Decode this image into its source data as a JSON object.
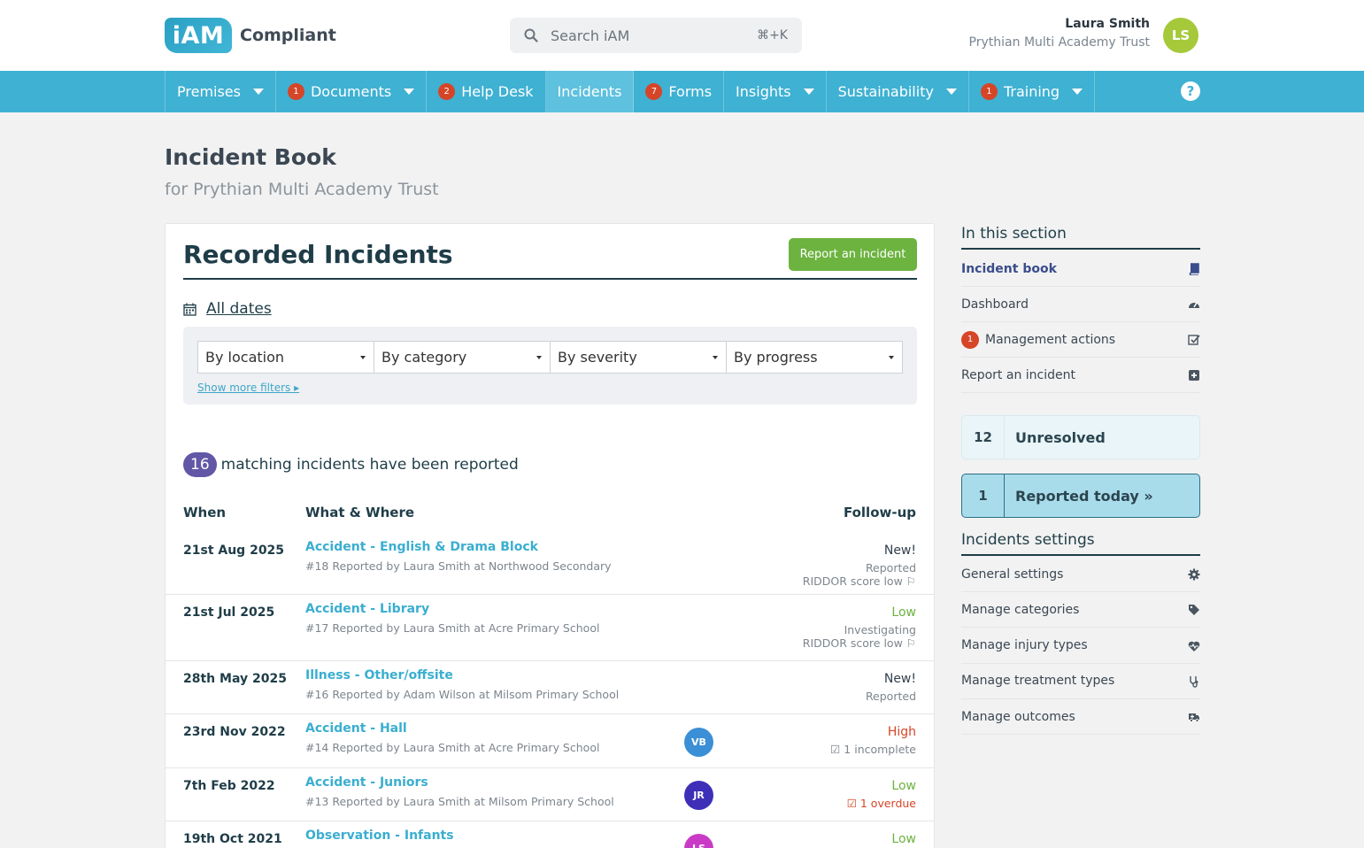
{
  "header": {
    "logo_mark": "iAM",
    "logo_text": "Compliant",
    "search_placeholder": "Search iAM",
    "search_shortcut": "⌘+K",
    "user_name": "Laura Smith",
    "user_org": "Prythian Multi Academy Trust",
    "user_initials": "LS"
  },
  "nav": {
    "items": [
      {
        "label": "Premises",
        "badge": "",
        "dropdown": true
      },
      {
        "label": "Documents",
        "badge": "1",
        "dropdown": true
      },
      {
        "label": "Help Desk",
        "badge": "2",
        "dropdown": false
      },
      {
        "label": "Incidents",
        "badge": "",
        "dropdown": false,
        "active": true
      },
      {
        "label": "Forms",
        "badge": "7",
        "dropdown": false
      },
      {
        "label": "Insights",
        "badge": "",
        "dropdown": true
      },
      {
        "label": "Sustainability",
        "badge": "",
        "dropdown": true
      },
      {
        "label": "Training",
        "badge": "1",
        "dropdown": true
      }
    ],
    "help_glyph": "?"
  },
  "page": {
    "title": "Incident Book",
    "subtitle": "for Prythian Multi Academy Trust"
  },
  "incidents": {
    "title": "Recorded Incidents",
    "report_button": "Report an incident",
    "dates_label": "All dates",
    "filters": [
      "By location",
      "By category",
      "By severity",
      "By progress"
    ],
    "more_filters": "Show more filters ▸",
    "count": "16",
    "count_text": "matching incidents have been reported",
    "headers": {
      "when": "When",
      "what": "What & Where",
      "followup": "Follow-up"
    },
    "rows": [
      {
        "when": "21st Aug 2025",
        "what": "Accident - English & Drama Block",
        "meta": "#18 Reported by Laura Smith at Northwood Secondary",
        "severity": "New!",
        "severity_color": "#33414e",
        "status": "Reported",
        "riddor": "RIDDOR score low ⚐",
        "assignee": "",
        "assignee_color": ""
      },
      {
        "when": "21st Jul 2025",
        "what": "Accident - Library",
        "meta": "#17 Reported by Laura Smith at Acre Primary School",
        "severity": "Low",
        "severity_color": "#6cb33f",
        "status": "Investigating",
        "riddor": "RIDDOR score low ⚐",
        "assignee": "",
        "assignee_color": ""
      },
      {
        "when": "28th May 2025",
        "what": "Illness - Other/offsite",
        "meta": "#16 Reported by Adam Wilson at Milsom Primary School",
        "severity": "New!",
        "severity_color": "#33414e",
        "status": "Reported",
        "riddor": "",
        "assignee": "",
        "assignee_color": ""
      },
      {
        "when": "23rd Nov 2022",
        "what": "Accident - Hall",
        "meta": "#14 Reported by Laura Smith at Acre Primary School",
        "severity": "High",
        "severity_color": "#d64527",
        "status": "☑ 1 incomplete",
        "status_color": "#7d858d",
        "riddor": "",
        "assignee": "VB",
        "assignee_color": "#3a8fd6"
      },
      {
        "when": "7th Feb 2022",
        "what": "Accident - Juniors",
        "meta": "#13 Reported by Laura Smith at Milsom Primary School",
        "severity": "Low",
        "severity_color": "#6cb33f",
        "status": "☑ 1 overdue",
        "status_color": "#d64527",
        "riddor": "",
        "assignee": "JR",
        "assignee_color": "#3d2fb8"
      },
      {
        "when": "19th Oct 2021",
        "what": "Observation - Infants",
        "meta": "",
        "severity": "Low",
        "severity_color": "#6cb33f",
        "status": "",
        "riddor": "",
        "assignee": "LS",
        "assignee_color": "#c93bc6"
      }
    ]
  },
  "sidebar": {
    "section_title": "In this section",
    "items": [
      {
        "label": "Incident book",
        "icon": "book-icon",
        "current": true,
        "badge": ""
      },
      {
        "label": "Dashboard",
        "icon": "gauge-icon",
        "current": false,
        "badge": ""
      },
      {
        "label": "Management actions",
        "icon": "checkbox-icon",
        "current": false,
        "badge": "1"
      },
      {
        "label": "Report an incident",
        "icon": "plus-square-icon",
        "current": false,
        "badge": ""
      }
    ],
    "stats": [
      {
        "num": "12",
        "label": "Unresolved"
      },
      {
        "num": "1",
        "label": "Reported today »"
      }
    ],
    "settings_title": "Incidents settings",
    "settings": [
      {
        "label": "General settings",
        "icon": "gear-icon"
      },
      {
        "label": "Manage categories",
        "icon": "tag-icon"
      },
      {
        "label": "Manage injury types",
        "icon": "heart-pulse-icon"
      },
      {
        "label": "Manage treatment types",
        "icon": "stethoscope-icon"
      },
      {
        "label": "Manage outcomes",
        "icon": "ambulance-icon"
      }
    ]
  }
}
